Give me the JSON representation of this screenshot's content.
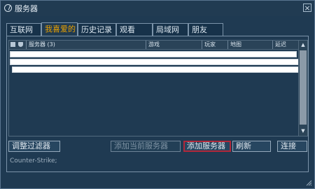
{
  "window": {
    "title": "服务器",
    "close_label": "×"
  },
  "tabs": [
    {
      "label": "互联网"
    },
    {
      "label": "我喜爱的"
    },
    {
      "label": "历史记录"
    },
    {
      "label": "观看"
    },
    {
      "label": "局域网"
    },
    {
      "label": "朋友"
    }
  ],
  "table": {
    "columns": [
      {
        "label": "服务器 (3)"
      },
      {
        "label": "游戏"
      },
      {
        "label": "玩家"
      },
      {
        "label": "地图"
      },
      {
        "label": "延迟"
      }
    ]
  },
  "buttons": {
    "adjust_filter": "调整过滤器",
    "add_current": "添加当前服务器",
    "add_server": "添加服务器",
    "refresh": "刷新",
    "connect": "连接"
  },
  "status": {
    "filter_text": "Counter-Strike;"
  },
  "colors": {
    "background": "#1f3a52",
    "active_tab": "#e8a000",
    "focus_border": "#b0283a"
  },
  "icons": {
    "title": "steam-icon",
    "lock": "lock-icon",
    "shield": "shield-icon"
  }
}
